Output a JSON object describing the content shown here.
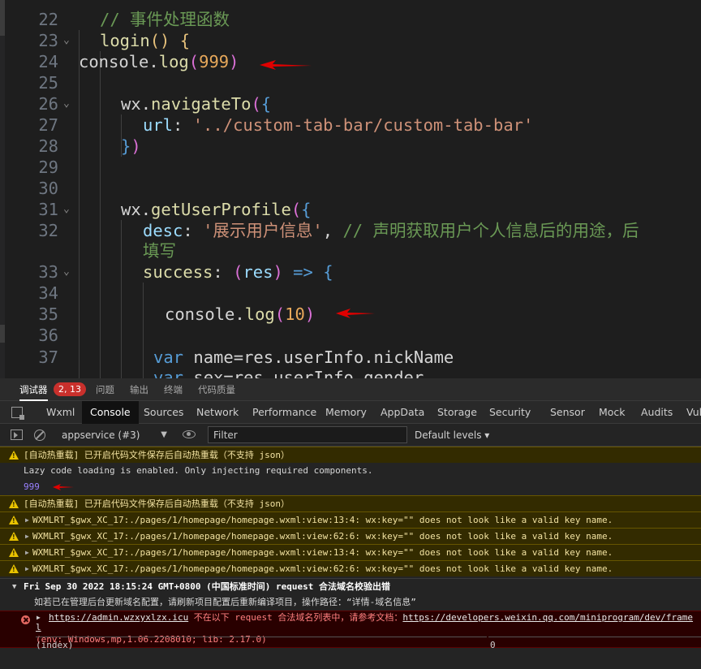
{
  "editor": {
    "lines": [
      {
        "n": "22",
        "fold": "",
        "tokens": [
          [
            "t-comment",
            "// 事件处理函数"
          ]
        ]
      },
      {
        "n": "23",
        "fold": "⌄",
        "tokens": [
          [
            "t-func",
            "login"
          ],
          [
            "t-yellow",
            "()"
          ],
          [
            "t-white",
            " "
          ],
          [
            "t-yellow",
            "{"
          ]
        ]
      },
      {
        "n": "24",
        "fold": "",
        "tokens": [
          [
            "t-white",
            "console"
          ],
          [
            "t-white",
            "."
          ],
          [
            "t-func",
            "log"
          ],
          [
            "t-paren",
            "("
          ],
          [
            "t-num",
            "999"
          ],
          [
            "t-paren",
            ")"
          ]
        ]
      },
      {
        "n": "25",
        "fold": "",
        "tokens": []
      },
      {
        "n": "26",
        "fold": "⌄",
        "tokens": [
          [
            "t-white",
            "wx"
          ],
          [
            "t-white",
            "."
          ],
          [
            "t-func",
            "navigateTo"
          ],
          [
            "t-paren",
            "("
          ],
          [
            "t-brace",
            "{"
          ]
        ]
      },
      {
        "n": "27",
        "fold": "",
        "tokens": [
          [
            "t-prop",
            "url"
          ],
          [
            "t-white",
            ": "
          ],
          [
            "t-str",
            "'../custom-tab-bar/custom-tab-bar'"
          ]
        ]
      },
      {
        "n": "28",
        "fold": "",
        "tokens": [
          [
            "t-brace",
            "}"
          ],
          [
            "t-paren",
            ")"
          ]
        ]
      },
      {
        "n": "29",
        "fold": "",
        "tokens": []
      },
      {
        "n": "30",
        "fold": "",
        "tokens": []
      },
      {
        "n": "31",
        "fold": "⌄",
        "tokens": [
          [
            "t-white",
            "wx"
          ],
          [
            "t-white",
            "."
          ],
          [
            "t-func",
            "getUserProfile"
          ],
          [
            "t-paren",
            "("
          ],
          [
            "t-brace",
            "{"
          ]
        ]
      },
      {
        "n": "32",
        "fold": "",
        "tokens": [
          [
            "t-prop",
            "desc"
          ],
          [
            "t-white",
            ": "
          ],
          [
            "t-str",
            "'展示用户信息'"
          ],
          [
            "t-white",
            ", "
          ],
          [
            "t-comment",
            "// 声明获取用户个人信息后的用途，后"
          ]
        ]
      },
      {
        "n": "",
        "fold": "",
        "tokens": [
          [
            "t-comment",
            "填写"
          ]
        ]
      },
      {
        "n": "33",
        "fold": "⌄",
        "tokens": [
          [
            "t-func",
            "success"
          ],
          [
            "t-white",
            ": "
          ],
          [
            "t-paren",
            "("
          ],
          [
            "t-prop",
            "res"
          ],
          [
            "t-paren",
            ")"
          ],
          [
            "t-white",
            " "
          ],
          [
            "t-arrow",
            "=>"
          ],
          [
            "t-white",
            " "
          ],
          [
            "t-brace",
            "{"
          ]
        ]
      },
      {
        "n": "34",
        "fold": "",
        "tokens": []
      },
      {
        "n": "35",
        "fold": "",
        "tokens": [
          [
            "t-white",
            "console"
          ],
          [
            "t-white",
            "."
          ],
          [
            "t-func",
            "log"
          ],
          [
            "t-paren",
            "("
          ],
          [
            "t-num",
            "10"
          ],
          [
            "t-paren",
            ")"
          ]
        ]
      },
      {
        "n": "36",
        "fold": "",
        "tokens": []
      },
      {
        "n": "37",
        "fold": "",
        "tokens": [
          [
            "t-keyword",
            "var"
          ],
          [
            "t-white",
            " name=res.userInfo.nickName"
          ]
        ]
      },
      {
        "n": "",
        "fold": "",
        "tokens": [
          [
            "t-keyword",
            "var"
          ],
          [
            "t-white",
            " sex=res.userInfo.gender"
          ]
        ]
      }
    ]
  },
  "devtools": {
    "top_tabs": {
      "debugger": "调试器",
      "badge": "2, 13",
      "issues": "问题",
      "output": "输出",
      "terminal": "终端",
      "code_quality": "代码质量"
    },
    "dev_tabs": [
      "Wxml",
      "Console",
      "Sources",
      "Network",
      "Performance",
      "Memory",
      "AppData",
      "Storage",
      "Security",
      "Sensor",
      "Mock",
      "Audits",
      "Vul"
    ],
    "toolbar": {
      "context": "appservice (#3)",
      "filter_placeholder": "Filter",
      "levels": "Default levels ▾"
    },
    "console": {
      "r1": "[自动热重载] 已开启代码文件保存后自动热重载（不支持 json）",
      "r2": "Lazy code loading is enabled. Only injecting required components.",
      "r3": "999",
      "r4": "[自动热重载] 已开启代码文件保存后自动热重载（不支持 json）",
      "r5": "WXMLRT_$gwx_XC_17:./pages/1/homepage/homepage.wxml:view:13:4: wx:key=\"\" does not look like a valid key name.",
      "r6": "WXMLRT_$gwx_XC_17:./pages/1/homepage/homepage.wxml:view:62:6: wx:key=\"\" does not look like a valid key name.",
      "r7": "WXMLRT_$gwx_XC_17:./pages/1/homepage/homepage.wxml:view:13:4: wx:key=\"\" does not look like a valid key name.",
      "r8": "WXMLRT_$gwx_XC_17:./pages/1/homepage/homepage.wxml:view:62:6: wx:key=\"\" does not look like a valid key name.",
      "group": "Fri Sep 30 2022 18:15:24 GMT+0800 (中国标准时间) request 合法域名校验出错",
      "hint": "如若已在管理后台更新域名配置，请刷新项目配置后重新编译项目，操作路径：“详情-域名信息”",
      "err_url": "https://admin.wzxyxlzx.icu",
      "err_msg": " 不在以下 request 合法域名列表中，请参考文档：",
      "err_doc": "https://developers.weixin.qq.com/miniprogram/dev/frame",
      "err_doc2": "l",
      "err_env": "(env: Windows,mp,1.06.2208010; lib: 2.17.0)",
      "table_key": "(index)",
      "table_val": "0"
    }
  }
}
